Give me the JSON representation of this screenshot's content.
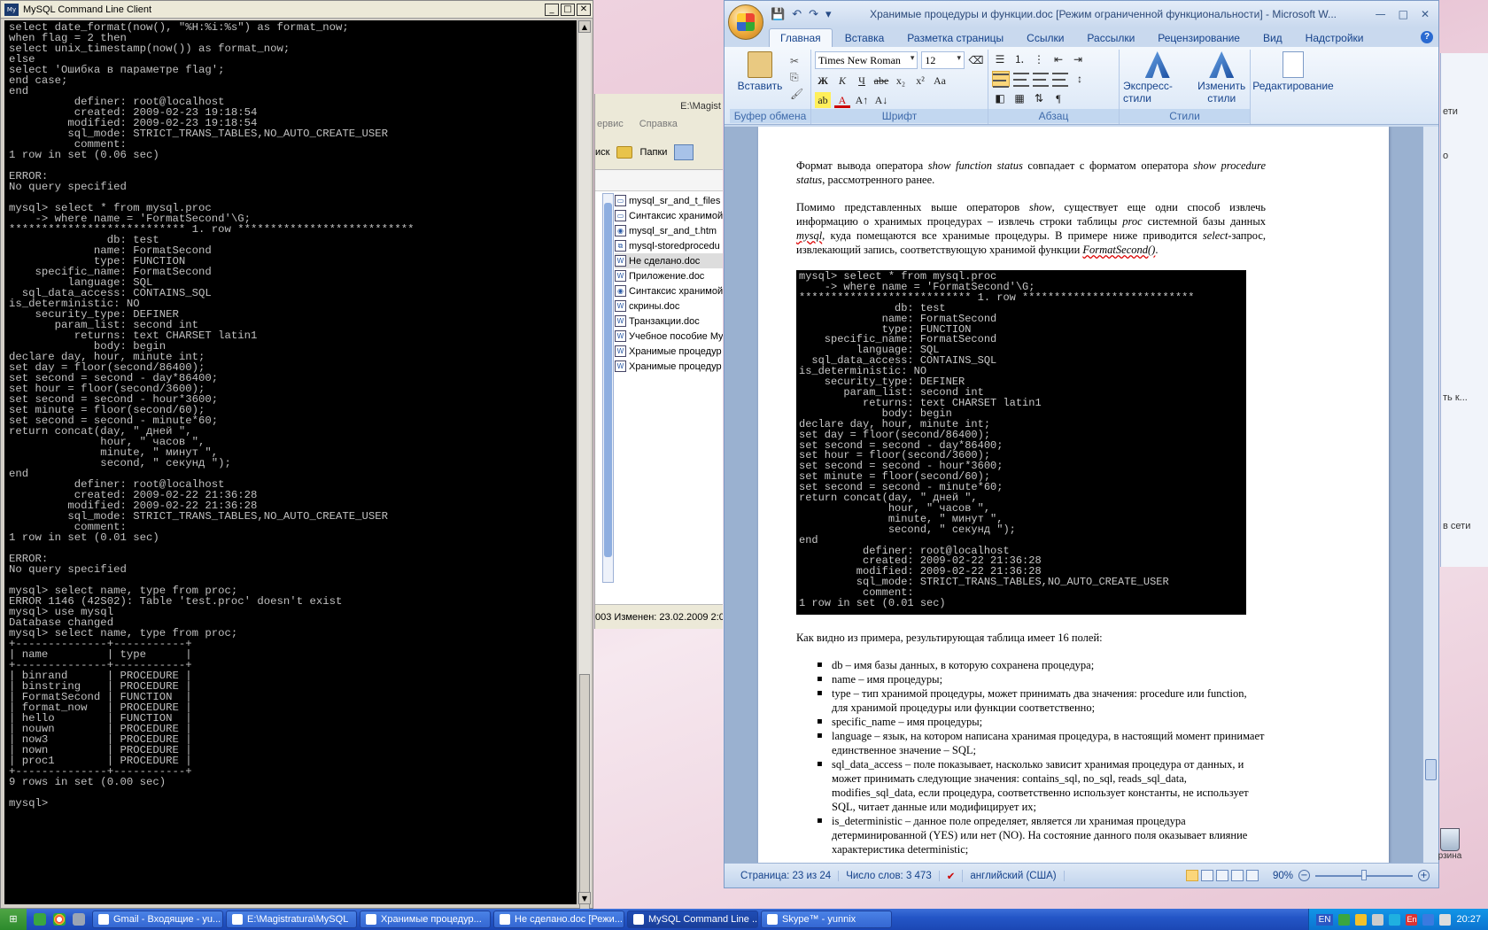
{
  "mysql": {
    "title": "MySQL Command Line Client",
    "console_lines": [
      "select date_format(now(), \"%H:%i:%s\") as format_now;",
      "when flag = 2 then",
      "select unix_timestamp(now()) as format_now;",
      "else",
      "select 'Ошибка в параметре flag';",
      "end case;",
      "end",
      "          definer: root@localhost",
      "          created: 2009-02-23 19:18:54",
      "         modified: 2009-02-23 19:18:54",
      "         sql_mode: STRICT_TRANS_TABLES,NO_AUTO_CREATE_USER",
      "          comment:",
      "1 row in set (0.06 sec)",
      "",
      "ERROR:",
      "No query specified",
      "",
      "mysql> select * from mysql.proc",
      "    -> where name = 'FormatSecond'\\G;",
      "*************************** 1. row ***************************",
      "               db: test",
      "             name: FormatSecond",
      "             type: FUNCTION",
      "    specific_name: FormatSecond",
      "         language: SQL",
      "  sql_data_access: CONTAINS_SQL",
      "is_deterministic: NO",
      "    security_type: DEFINER",
      "       param_list: second int",
      "          returns: text CHARSET latin1",
      "             body: begin",
      "declare day, hour, minute int;",
      "set day = floor(second/86400);",
      "set second = second - day*86400;",
      "set hour = floor(second/3600);",
      "set second = second - hour*3600;",
      "set minute = floor(second/60);",
      "set second = second - minute*60;",
      "return concat(day, \" дней \",",
      "              hour, \" часов \",",
      "              minute, \" минут \",",
      "              second, \" секунд \");",
      "end",
      "          definer: root@localhost",
      "          created: 2009-02-22 21:36:28",
      "         modified: 2009-02-22 21:36:28",
      "         sql_mode: STRICT_TRANS_TABLES,NO_AUTO_CREATE_USER",
      "          comment:",
      "1 row in set (0.01 sec)",
      "",
      "ERROR:",
      "No query specified",
      "",
      "mysql> select name, type from proc;",
      "ERROR 1146 (42S02): Table 'test.proc' doesn't exist",
      "mysql> use mysql",
      "Database changed",
      "mysql> select name, type from proc;",
      "+--------------+-----------+",
      "| name         | type      |",
      "+--------------+-----------+",
      "| binrand      | PROCEDURE |",
      "| binstring    | PROCEDURE |",
      "| FormatSecond | FUNCTION  |",
      "| format_now   | PROCEDURE |",
      "| hello        | FUNCTION  |",
      "| nouwn        | PROCEDURE |",
      "| now3         | PROCEDURE |",
      "| nown         | PROCEDURE |",
      "| proc1        | PROCEDURE |",
      "+--------------+-----------+",
      "9 rows in set (0.00 sec)",
      "",
      "mysql>"
    ]
  },
  "explorer": {
    "title": "E:\\Magist",
    "menu": [
      "ервис",
      "Справка"
    ],
    "toolbar_search": "иск",
    "toolbar_folders": "Папки",
    "files": [
      {
        "name": "mysql_sr_and_t_files",
        "icon": "folder-icon"
      },
      {
        "name": "Синтаксис хранимой",
        "icon": "folder-icon"
      },
      {
        "name": "mysql_sr_and_t.htm",
        "icon": "browser-icon"
      },
      {
        "name": "mysql-storedprocedu",
        "icon": "pdf-icon"
      },
      {
        "name": "Не сделано.doc",
        "icon": "word-doc-icon"
      },
      {
        "name": "Приложение.doc",
        "icon": "word-doc-icon"
      },
      {
        "name": "Синтаксис хранимой",
        "icon": "browser-icon"
      },
      {
        "name": "скрины.doc",
        "icon": "word-doc-icon"
      },
      {
        "name": "Транзакции.doc",
        "icon": "word-doc-icon"
      },
      {
        "name": "Учебное пособие My",
        "icon": "word-doc-icon"
      },
      {
        "name": "Хранимые процедур",
        "icon": "word-doc-icon"
      },
      {
        "name": "Хранимые процедур",
        "icon": "word-doc-icon"
      }
    ],
    "status": "003 Изменен: 23.02.2009 2:0"
  },
  "word": {
    "title": "Хранимые процедуры и функции.doc [Режим ограниченной функциональности] - Microsoft W...",
    "tabs": [
      "Главная",
      "Вставка",
      "Разметка страницы",
      "Ссылки",
      "Рассылки",
      "Рецензирование",
      "Вид",
      "Надстройки"
    ],
    "ribbon": {
      "clipboard_label": "Буфер обмена",
      "paste_label": "Вставить",
      "font_label": "Шрифт",
      "font_name": "Times New Roman",
      "font_size": "12",
      "paragraph_label": "Абзац",
      "styles_label": "Стили",
      "express_styles": "Экспресс-стили",
      "change_styles": "Изменить стили",
      "editing_label": "Редактирование"
    },
    "doc": {
      "p1_a": "Формат вывода оператора ",
      "p1_b": "show function status",
      "p1_c": " совпадает с форматом оператора ",
      "p1_d": "show procedure status",
      "p1_e": ", рассмотренного ранее.",
      "p2_a": "Помимо представленных выше операторов ",
      "p2_b": "show",
      "p2_c": ", существует еще одни способ извлечь информацию о хранимых процедурах – извлечь строки таблицы ",
      "p2_d": "proc",
      "p2_e": " системной базы данных ",
      "p2_f": "mysql",
      "p2_g": ", куда помещаются все хранимые процедуры. В примере ниже приводится ",
      "p2_h": "select",
      "p2_i": "-запрос, извлекающий запись, соответствующую хранимой функции ",
      "p2_j": "FormatSecond()",
      "p2_k": ".",
      "console_lines": [
        "mysql> select * from mysql.proc",
        "    -> where name = 'FormatSecond'\\G;",
        "*************************** 1. row ***************************",
        "               db: test",
        "             name: FormatSecond",
        "             type: FUNCTION",
        "    specific_name: FormatSecond",
        "         language: SQL",
        "  sql_data_access: CONTAINS_SQL",
        "is_deterministic: NO",
        "    security_type: DEFINER",
        "       param_list: second int",
        "          returns: text CHARSET latin1",
        "             body: begin",
        "declare day, hour, minute int;",
        "set day = floor(second/86400);",
        "set second = second - day*86400;",
        "set hour = floor(second/3600);",
        "set second = second - hour*3600;",
        "set minute = floor(second/60);",
        "set second = second - minute*60;",
        "return concat(day, \" дней \",",
        "              hour, \" часов \",",
        "              minute, \" минут \",",
        "              second, \" секунд \");",
        "end",
        "          definer: root@localhost",
        "          created: 2009-02-22 21:36:28",
        "         modified: 2009-02-22 21:36:28",
        "         sql_mode: STRICT_TRANS_TABLES,NO_AUTO_CREATE_USER",
        "          comment:",
        "1 row in set (0.01 sec)"
      ],
      "p3": "Как видно из примера, результирующая таблица имеет 16 полей:",
      "bullets": [
        [
          "db",
          " – имя базы данных, в которую сохранена процедура;"
        ],
        [
          "name",
          " – имя процедуры;"
        ],
        [
          "type",
          " – тип хранимой процедуры, может принимать два значения: procedure или function, для хранимой процедуры или функции соответственно;"
        ],
        [
          "specific_name",
          " – имя процедуры;"
        ],
        [
          "language",
          " – язык, на котором написана хранимая процедура, в настоящий момент принимает единственное значение – SQL;"
        ],
        [
          "sql_data_access",
          " – поле показывает, насколько зависит хранимая процедура от данных, и может принимать следующие значения: contains_sql, no_sql, reads_sql_data, modifies_sql_data, если процедура, соответственно использует константы, не использует SQL, читает данные или модифицирует их;"
        ],
        [
          "is_deterministic",
          " – данное поле определяет, является ли хранимая процедура детерминированной (YES) или нет (NO). На состояние данного поля оказывает влияние характеристика deterministic;"
        ]
      ]
    },
    "status": {
      "page": "Страница: 23 из 24",
      "words": "Число слов: 3 473",
      "language": "английский (США)",
      "zoom": "90%",
      "zoom_level": 0.5
    }
  },
  "bg_right": {
    "frag1": "ети",
    "frag2": "о",
    "frag3": "ть к...",
    "frag4": "в сети",
    "frag5": "рзина"
  },
  "taskbar": {
    "tasks": [
      {
        "label": "Gmail - Входящие - yu...",
        "active": false
      },
      {
        "label": "E:\\Magistratura\\MySQL",
        "active": false
      },
      {
        "label": "Хранимые процедур...",
        "active": false
      },
      {
        "label": "Не сделано.doc [Режи...",
        "active": false
      },
      {
        "label": "MySQL Command Line ...",
        "active": true
      },
      {
        "label": "Skype™ - yunnix",
        "active": false
      }
    ],
    "lang1": "EN",
    "lang2": "En",
    "clock": "20:27"
  }
}
